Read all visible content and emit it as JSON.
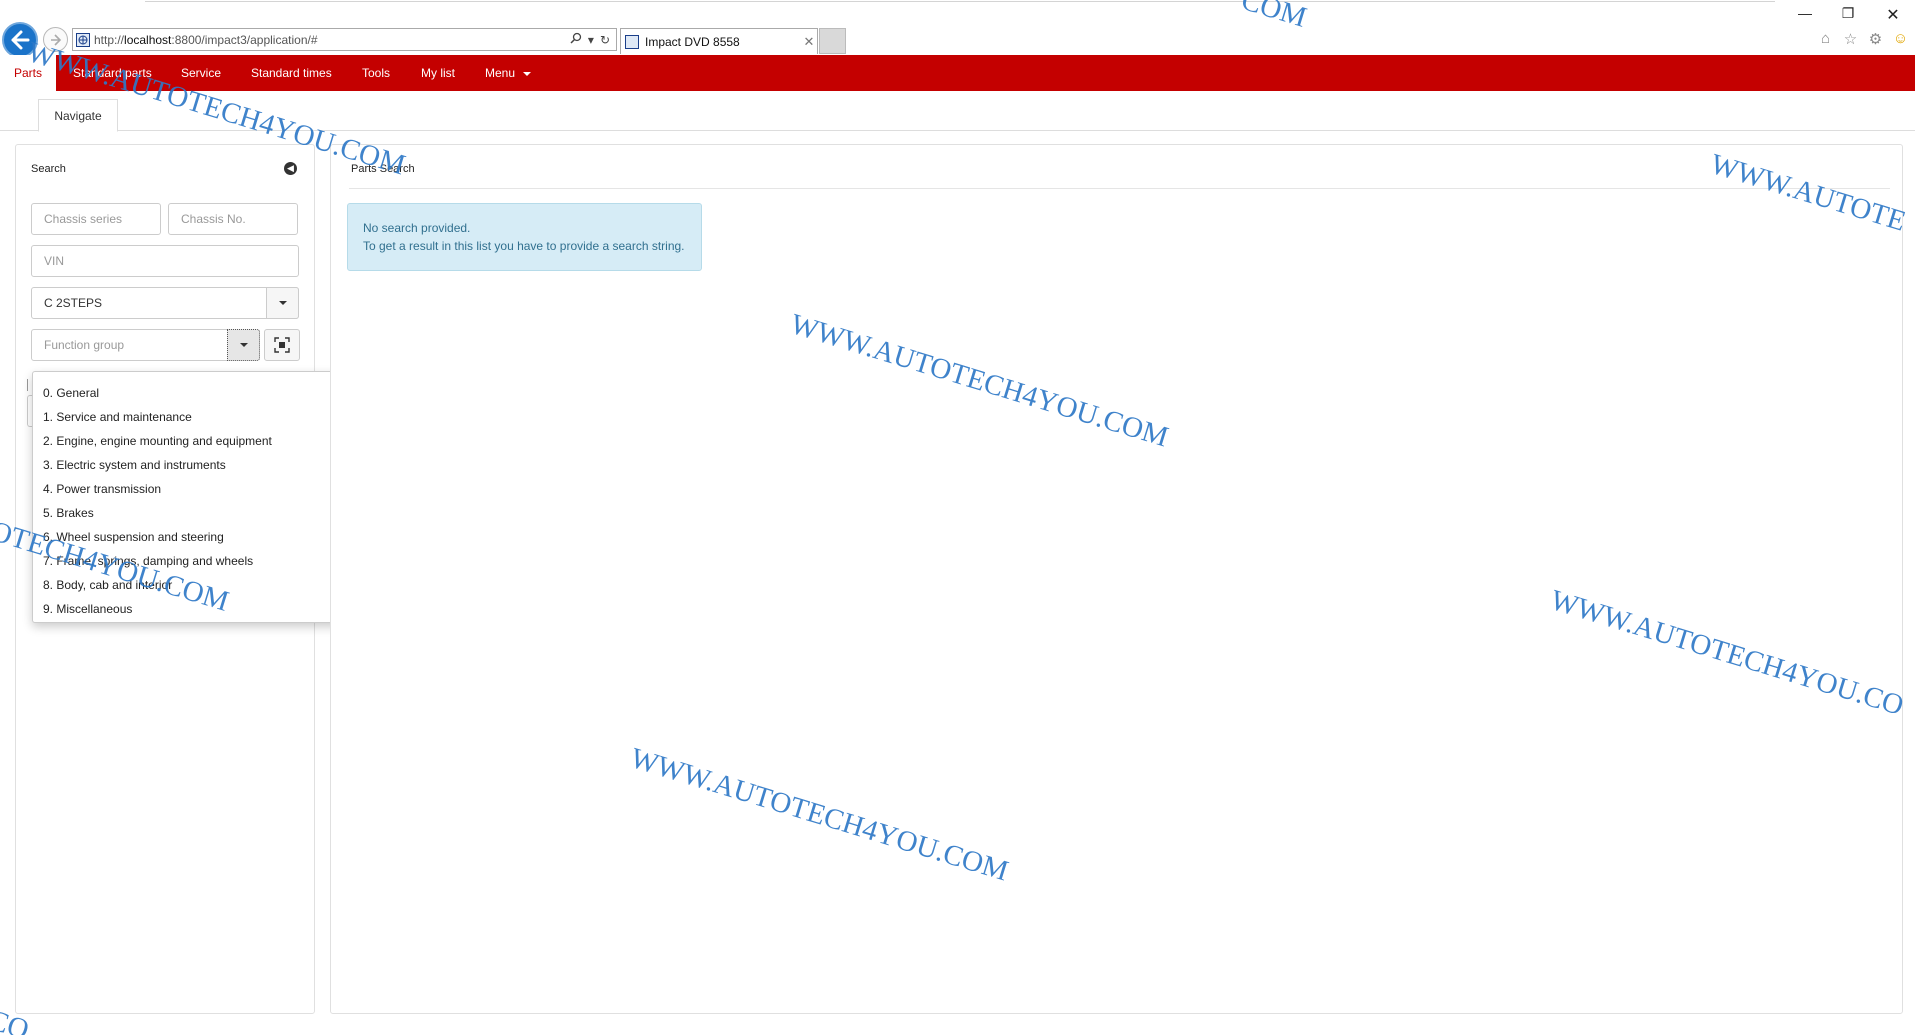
{
  "browser": {
    "url_prefix": "http://",
    "url_host": "localhost",
    "url_path": ":8800/impact3/application/#",
    "tab_title": "Impact DVD 8558",
    "window_controls": [
      "minimize-icon",
      "restore-icon",
      "close-icon"
    ],
    "toolbar_icons": [
      "home-icon",
      "star-icon",
      "gear-icon",
      "smiley-icon"
    ]
  },
  "nav": {
    "items": [
      {
        "label": "Parts",
        "active": true
      },
      {
        "label": "Standard parts"
      },
      {
        "label": "Service"
      },
      {
        "label": "Standard times"
      },
      {
        "label": "Tools"
      },
      {
        "label": "My list"
      },
      {
        "label": "Menu"
      }
    ]
  },
  "subtab": {
    "label": "Navigate"
  },
  "search": {
    "title": "Search",
    "chassis_series_placeholder": "Chassis series",
    "chassis_no_placeholder": "Chassis No.",
    "vin_placeholder": "VIN",
    "selected_model": "C 2STEPS",
    "function_group_placeholder": "Function group"
  },
  "function_groups": [
    "0. General",
    "1. Service and maintenance",
    "2. Engine, engine mounting and equipment",
    "3. Electric system and instruments",
    "4. Power transmission",
    "5. Brakes",
    "6. Wheel suspension and steering",
    "7. Frame, springs, damping and wheels",
    "8. Body, cab and interior",
    "9. Miscellaneous"
  ],
  "results": {
    "title": "Parts Search",
    "info_line1": "No search provided.",
    "info_line2": "To get a result in this list you have to provide a search string."
  },
  "watermark": {
    "text": "WWW.AUTOTECH4YOU.COM",
    "partial_right": "WWW.AUTOTE",
    "partial_bottom_right": "WWW.AUTOTECH4YOU.CO",
    "partial_top": "COM",
    "partial_left": "OTECH4YOU.COM",
    "partial_corner": "CO",
    "color": "#2f79c7"
  },
  "colors": {
    "brand_red": "#c40000",
    "info_bg": "#d6ecf6",
    "info_text": "#31708f"
  }
}
